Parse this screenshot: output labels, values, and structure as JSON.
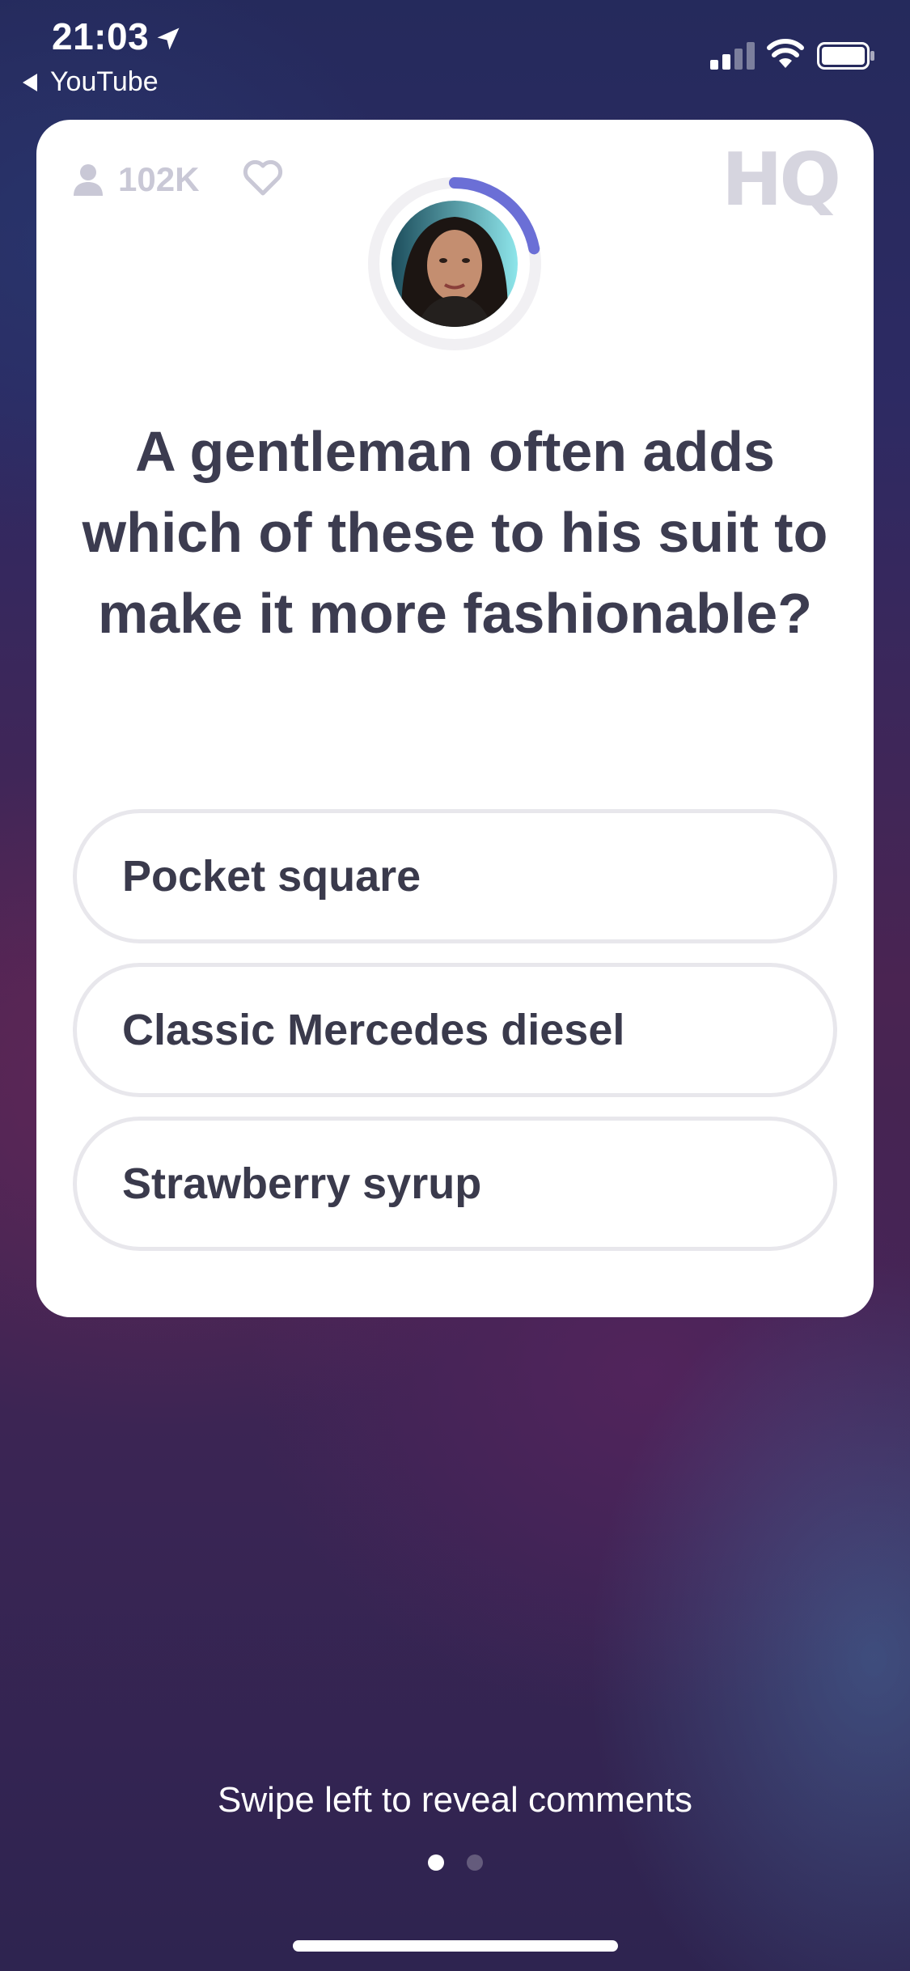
{
  "status_bar": {
    "time": "21:03",
    "back_app": "YouTube",
    "icons": [
      "location-arrow-icon",
      "cellular-signal-icon",
      "wifi-icon",
      "battery-icon"
    ]
  },
  "card": {
    "viewer_count": "102K",
    "logo": "HQ",
    "timer_progress": 0.22,
    "question": "A gentleman often adds which of these to his suit to make it more fashionable?",
    "answers": [
      "Pocket square",
      "Classic Mercedes diesel",
      "Strawberry syrup"
    ]
  },
  "footer": {
    "hint": "Swipe left to reveal comments",
    "page_count": 2,
    "active_page": 1
  },
  "colors": {
    "timer_accent": "#6b6fd6",
    "card_bg": "#ffffff",
    "text_dark": "#3c3c50"
  }
}
